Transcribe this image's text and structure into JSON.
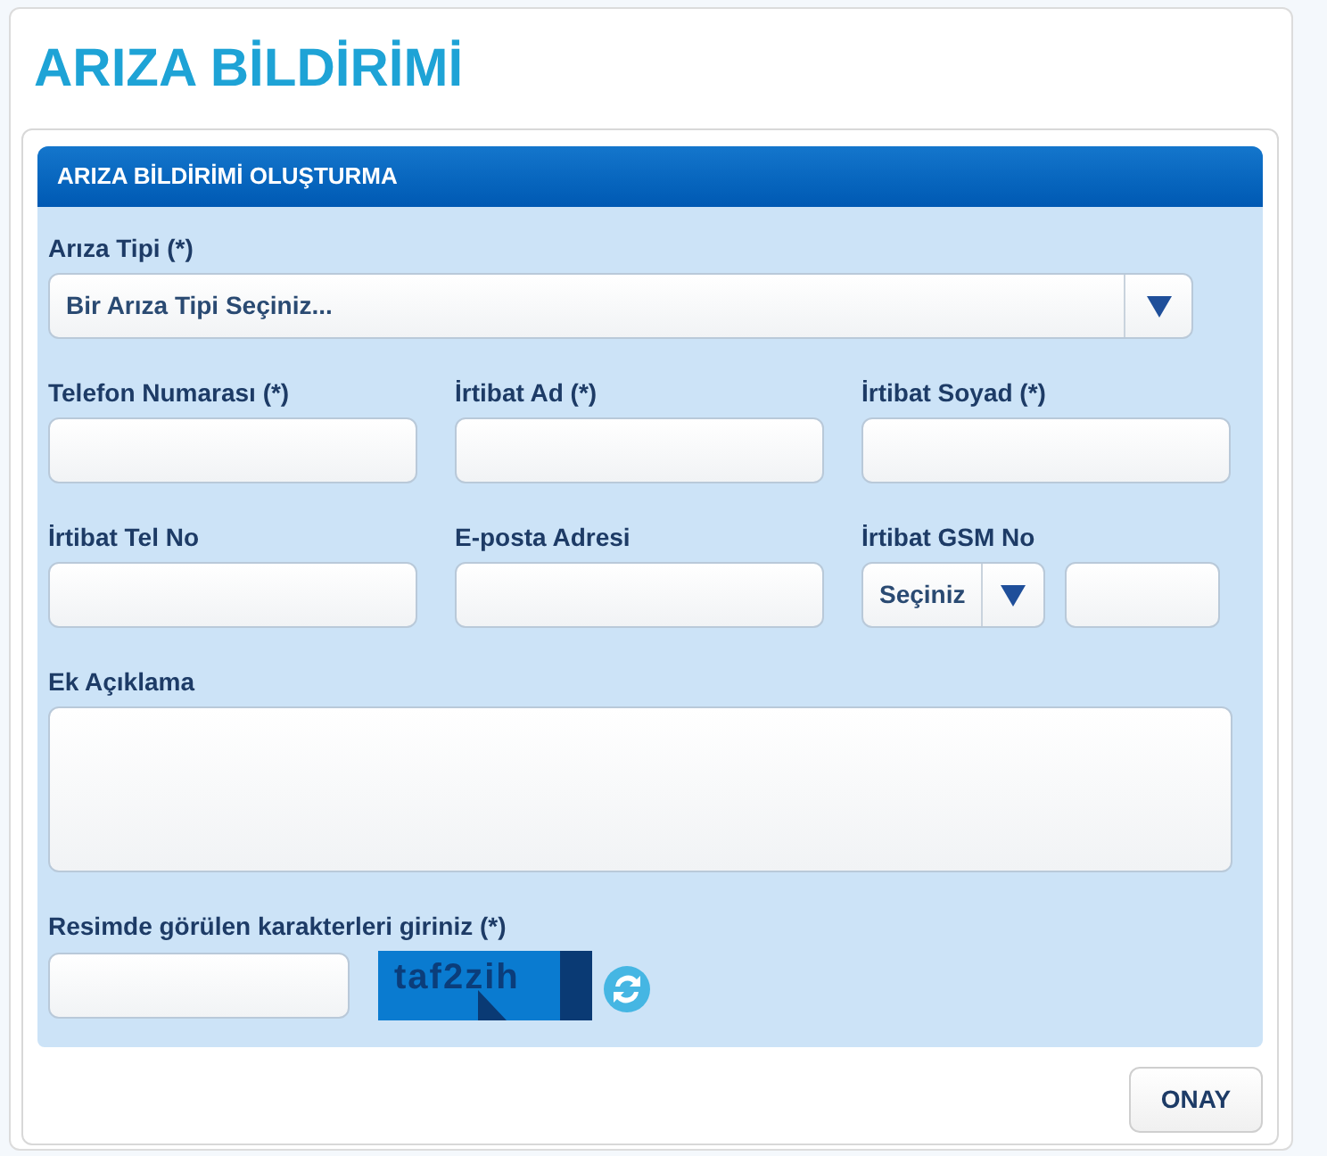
{
  "page_title": "ARIZA BİLDİRİMİ",
  "panel": {
    "title": "ARIZA BİLDİRİMİ OLUŞTURMA",
    "fault_type": {
      "label": "Arıza Tipi (*)",
      "value": "Bir Arıza Tipi Seçiniz..."
    },
    "rows": [
      [
        {
          "kind": "input",
          "label": "Telefon Numarası (*)"
        },
        {
          "kind": "input",
          "label": "İrtibat Ad (*)"
        },
        {
          "kind": "input",
          "label": "İrtibat Soyad (*)"
        }
      ],
      [
        {
          "kind": "input",
          "label": "İrtibat Tel No"
        },
        {
          "kind": "input",
          "label": "E-posta Adresi"
        },
        {
          "kind": "gsm",
          "label": "İrtibat GSM No",
          "select_value": "Seçiniz"
        }
      ]
    ],
    "note": {
      "label": "Ek Açıklama"
    },
    "captcha": {
      "label": "Resimde görülen karakterleri giriniz (*)",
      "code": "taf2zih"
    }
  },
  "submit_button": "ONAY"
}
